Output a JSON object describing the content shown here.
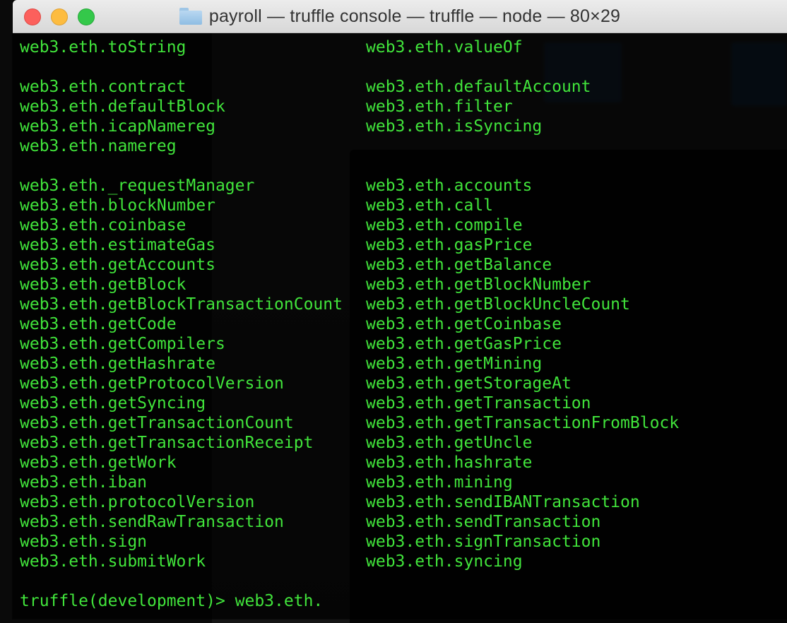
{
  "window": {
    "title": "payroll — truffle console — truffle — node — 80×29"
  },
  "terminal": {
    "color": "#41e43b",
    "groups": [
      [
        [
          "web3.eth.toString",
          "web3.eth.valueOf"
        ]
      ],
      [
        [
          "web3.eth.contract",
          "web3.eth.defaultAccount"
        ],
        [
          "web3.eth.defaultBlock",
          "web3.eth.filter"
        ],
        [
          "web3.eth.icapNamereg",
          "web3.eth.isSyncing"
        ],
        [
          "web3.eth.namereg",
          ""
        ]
      ],
      [
        [
          "web3.eth._requestManager",
          "web3.eth.accounts"
        ],
        [
          "web3.eth.blockNumber",
          "web3.eth.call"
        ],
        [
          "web3.eth.coinbase",
          "web3.eth.compile"
        ],
        [
          "web3.eth.estimateGas",
          "web3.eth.gasPrice"
        ],
        [
          "web3.eth.getAccounts",
          "web3.eth.getBalance"
        ],
        [
          "web3.eth.getBlock",
          "web3.eth.getBlockNumber"
        ],
        [
          "web3.eth.getBlockTransactionCount",
          "web3.eth.getBlockUncleCount"
        ],
        [
          "web3.eth.getCode",
          "web3.eth.getCoinbase"
        ],
        [
          "web3.eth.getCompilers",
          "web3.eth.getGasPrice"
        ],
        [
          "web3.eth.getHashrate",
          "web3.eth.getMining"
        ],
        [
          "web3.eth.getProtocolVersion",
          "web3.eth.getStorageAt"
        ],
        [
          "web3.eth.getSyncing",
          "web3.eth.getTransaction"
        ],
        [
          "web3.eth.getTransactionCount",
          "web3.eth.getTransactionFromBlock"
        ],
        [
          "web3.eth.getTransactionReceipt",
          "web3.eth.getUncle"
        ],
        [
          "web3.eth.getWork",
          "web3.eth.hashrate"
        ],
        [
          "web3.eth.iban",
          "web3.eth.mining"
        ],
        [
          "web3.eth.protocolVersion",
          "web3.eth.sendIBANTransaction"
        ],
        [
          "web3.eth.sendRawTransaction",
          "web3.eth.sendTransaction"
        ],
        [
          "web3.eth.sign",
          "web3.eth.signTransaction"
        ],
        [
          "web3.eth.submitWork",
          "web3.eth.syncing"
        ]
      ]
    ],
    "prompt": "truffle(development)> ",
    "input": "web3.eth."
  }
}
